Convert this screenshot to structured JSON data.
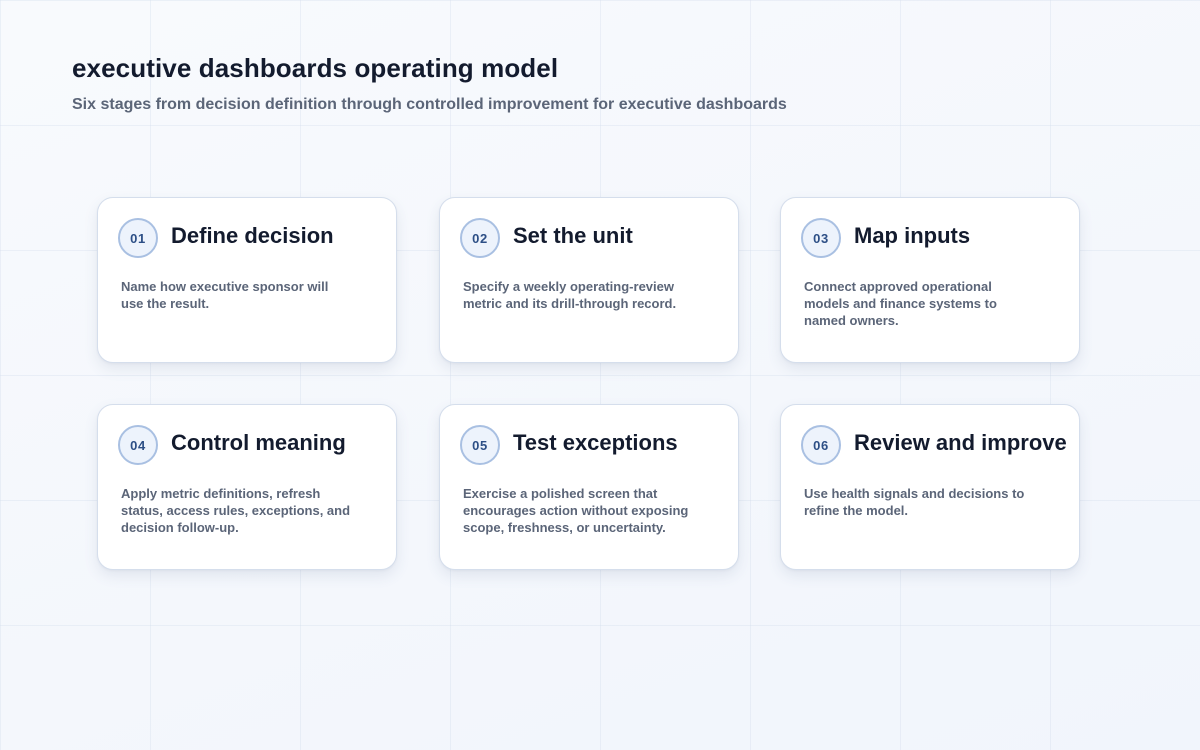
{
  "header": {
    "title": "executive dashboards operating model",
    "subtitle": "Six stages from decision definition through controlled improvement for executive dashboards"
  },
  "stages": [
    {
      "number": "01",
      "title": "Define decision",
      "description": "Name how executive sponsor will use the result."
    },
    {
      "number": "02",
      "title": "Set the unit",
      "description": "Specify a weekly operating-review metric and its drill-through record."
    },
    {
      "number": "03",
      "title": "Map inputs",
      "description": "Connect approved operational models and finance systems to named owners."
    },
    {
      "number": "04",
      "title": "Control meaning",
      "description": "Apply metric definitions, refresh status, access rules, exceptions, and decision follow-up."
    },
    {
      "number": "05",
      "title": "Test exceptions",
      "description": "Exercise a polished screen that encourages action without exposing scope, freshness, or uncertainty."
    },
    {
      "number": "06",
      "title": "Review and improve",
      "description": "Use health signals and decisions to refine the model."
    }
  ],
  "colors": {
    "background": "#f4f7fc",
    "card": "#ffffff",
    "badge_border": "#a9c0e2",
    "badge_fill": "#edf3fc",
    "badge_text": "#2d4f86",
    "title_text": "#131b2e",
    "body_text": "#5b6578"
  }
}
